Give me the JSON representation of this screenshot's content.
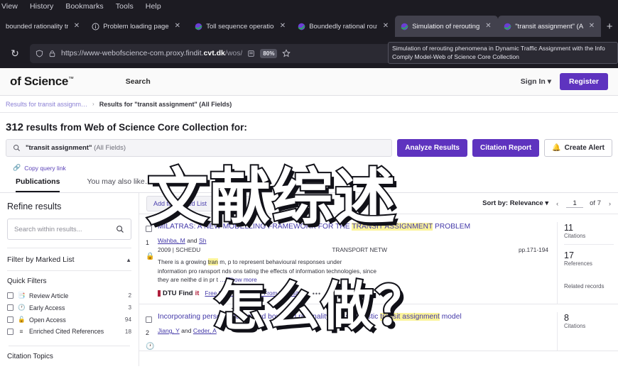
{
  "browser": {
    "menu_items": [
      "View",
      "History",
      "Bookmarks",
      "Tools",
      "Help"
    ],
    "tabs": [
      {
        "title": "bounded rationality traff",
        "active": false,
        "favicon": "generic-icon"
      },
      {
        "title": "Problem loading page",
        "active": false,
        "favicon": "info-icon"
      },
      {
        "title": "Toll sequence operation",
        "active": false,
        "favicon": "wos-icon"
      },
      {
        "title": "Boundedly rational route",
        "active": false,
        "favicon": "wos-icon"
      },
      {
        "title": "Simulation of rerouting",
        "active": true,
        "favicon": "wos-icon"
      },
      {
        "title": "\"transit assignment\" (All",
        "active": true,
        "favicon": "wos-icon"
      }
    ],
    "new_tab_label": "+",
    "reload_label": "↻",
    "url_prefix": "https://www-webofscience-com.proxy.findit.",
    "url_bold": "cvt.dk",
    "url_suffix": "/wos/",
    "zoom_level": "80%",
    "search_label": "Search",
    "reader_icon": "reader-view-icon",
    "bookmark_icon": "star-icon",
    "shield_icon": "shield-icon",
    "lock_icon": "lock-warning-icon",
    "tooltip_text": "Simulation of rerouting phenomena in Dynamic Traffic Assignment with the Info Comply Model-Web of Science Core Collection"
  },
  "site": {
    "logo": "of Science",
    "logo_tm": "™",
    "nav_search": "Search",
    "sign_in": "Sign In",
    "register": "Register",
    "breadcrumb_prev": "Results for transit assignm…",
    "breadcrumb_sep": "›",
    "breadcrumb_current": "Results for \"transit assignment\" (All Fields)"
  },
  "results_header": {
    "count": "312",
    "text": "results from Web of Science Core Collection for:",
    "query": "\"transit assignment\"",
    "query_fields": "(All Fields)",
    "search_icon": "search-icon",
    "btn_analyze": "Analyze Results",
    "btn_citation_report": "Citation Report",
    "btn_create_alert": "Create Alert",
    "bell_icon": "bell-icon",
    "copy_query_link": "Copy query link",
    "link_icon": "link-icon"
  },
  "content_tabs": [
    {
      "label": "Publications",
      "selected": true
    },
    {
      "label": "You may also like…",
      "selected": false
    }
  ],
  "sidebar": {
    "title": "Refine results",
    "search_placeholder": "Search within results...",
    "search_icon": "search-icon",
    "filter_by_marked_list": "Filter by Marked List",
    "chevron": "chevron-up-icon",
    "quick_filters_title": "Quick Filters",
    "quick_filters": [
      {
        "label": "Review Article",
        "count": "2",
        "icon": "review-article-icon"
      },
      {
        "label": "Early Access",
        "count": "3",
        "icon": "clock-icon"
      },
      {
        "label": "Open Access",
        "count": "94",
        "icon": "unlock-icon"
      },
      {
        "label": "Enriched Cited References",
        "count": "18",
        "icon": "list-plus-icon"
      }
    ],
    "citation_topics": "Citation Topics"
  },
  "toolbar": {
    "chips": [
      "Add to Marked List",
      "Export",
      "…"
    ],
    "sort_by": "Sort by: Relevance",
    "sort_caret": "▾",
    "prev_arrow": "‹",
    "page_value": "1",
    "of_label": "of 7",
    "next_arrow": "›"
  },
  "results": [
    {
      "num": "1",
      "access_icon": "open-access-lock-icon",
      "title_pre": "MILATRAS: A NEW MODELLING FRAMEWORK FOR THE ",
      "title_hl": "TRANSIT ASSIGNMENT",
      "title_post": " PROBLEM",
      "authors_a": "Wahba, M",
      "authors_and": " and ",
      "authors_b": "Sh",
      "meta_left": "2009 | SCHEDU",
      "meta_mid": "TRANSPORT NETW",
      "meta_right": "pp.171-194",
      "abstract_l1_a": "There is a growing",
      "abstract_l1_hl": "tran",
      "abstract_l1_b": "m, p",
      "abstract_l1_c": " to represent behavioural responses under",
      "abstract_l2_a": "information pro",
      "abstract_l2_b": "ransport",
      "abstract_l2_c": "nds",
      "abstract_l2_d": "ons t",
      "abstract_l2_e": "ating the effects of information technologies, since",
      "abstract_l3_a": "they are neithe",
      "abstract_l3_b": "d in",
      "abstract_l3_c": "pr",
      "abstract_l3_d": "t",
      "show_more": "… Show more",
      "findit_a": "DTU",
      "findit_b": "Find",
      "findit_c": "it",
      "repo_link": "Free Submitted Article From Repository",
      "dots": "•••",
      "citations": "11",
      "citations_label": "Citations",
      "references": "17",
      "references_label": "References",
      "related": "Related records"
    },
    {
      "num": "2",
      "access_icon": "early-access-clock-icon",
      "title_pre": "Incorporating personalization and bounded rationality into stochastic ",
      "title_hl": "transit assignment",
      "title_post": " model",
      "authors_a": "Jiang, Y",
      "authors_and": " and ",
      "authors_b": "Ceder, A",
      "citations": "8",
      "citations_label": "Citations"
    }
  ],
  "overlay": {
    "line1": "文献综述",
    "line2": "怎么做？"
  }
}
